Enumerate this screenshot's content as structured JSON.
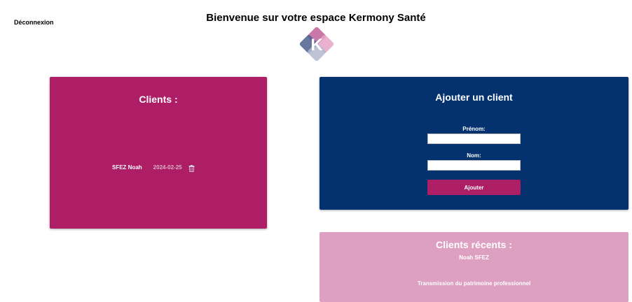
{
  "header": {
    "logout_label": "Déconnexion",
    "title": "Bienvenue sur votre espace Kermony Santé",
    "logo_letter": "K"
  },
  "clients_panel": {
    "title": "Clients :",
    "clients": [
      {
        "name": "SFEZ Noah",
        "date": "2024-02-25",
        "action_icon": "trash-icon"
      }
    ]
  },
  "add_client_panel": {
    "title": "Ajouter un client",
    "first_name_label": "Prénom:",
    "first_name_value": "",
    "last_name_label": "Nom:",
    "last_name_value": "",
    "submit_label": "Ajouter"
  },
  "recent_panel": {
    "title": "Clients récents :",
    "client_name": "Noah SFEZ",
    "subject": "Transmission du patrimoine professionnel"
  },
  "colors": {
    "clients_panel_bg": "#ad1e67",
    "add_panel_bg": "#03326f",
    "recent_panel_bg": "#dea0c1",
    "button_bg": "#ad1e67"
  }
}
